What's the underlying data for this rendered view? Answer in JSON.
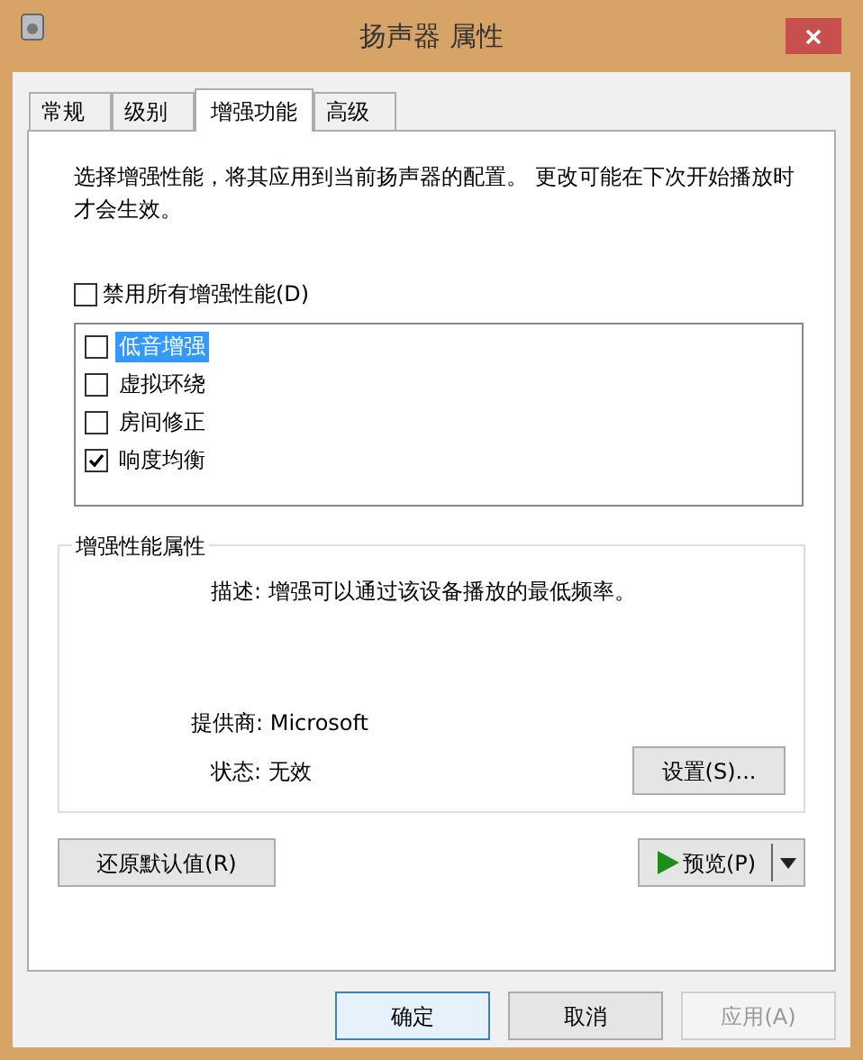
{
  "window": {
    "title": "扬声器 属性"
  },
  "tabs": [
    {
      "label": "常规",
      "selected": false
    },
    {
      "label": "级别",
      "selected": false
    },
    {
      "label": "增强功能",
      "selected": true
    },
    {
      "label": "高级",
      "selected": false
    }
  ],
  "intro": "选择增强性能，将其应用到当前扬声器的配置。 更改可能在下次开始播放时才会生效。",
  "disable_all": {
    "label": "禁用所有增强性能(D)",
    "checked": false
  },
  "enhancements": [
    {
      "label": "低音增强",
      "checked": false,
      "selected": true
    },
    {
      "label": "虚拟环绕",
      "checked": false,
      "selected": false
    },
    {
      "label": "房间修正",
      "checked": false,
      "selected": false
    },
    {
      "label": "响度均衡",
      "checked": true,
      "selected": false
    }
  ],
  "properties": {
    "title": "增强性能属性",
    "description": "描述: 增强可以通过该设备播放的最低频率。",
    "provider": "提供商: Microsoft",
    "status": "状态: 无效",
    "settings_button": "设置(S)..."
  },
  "restore_button": "还原默认值(R)",
  "preview_button": "预览(P)",
  "buttons": [
    {
      "label": "确定",
      "selected": true,
      "disabled": false
    },
    {
      "label": "取消",
      "selected": false,
      "disabled": false
    },
    {
      "label": "应用(A)",
      "selected": false,
      "disabled": true
    }
  ]
}
